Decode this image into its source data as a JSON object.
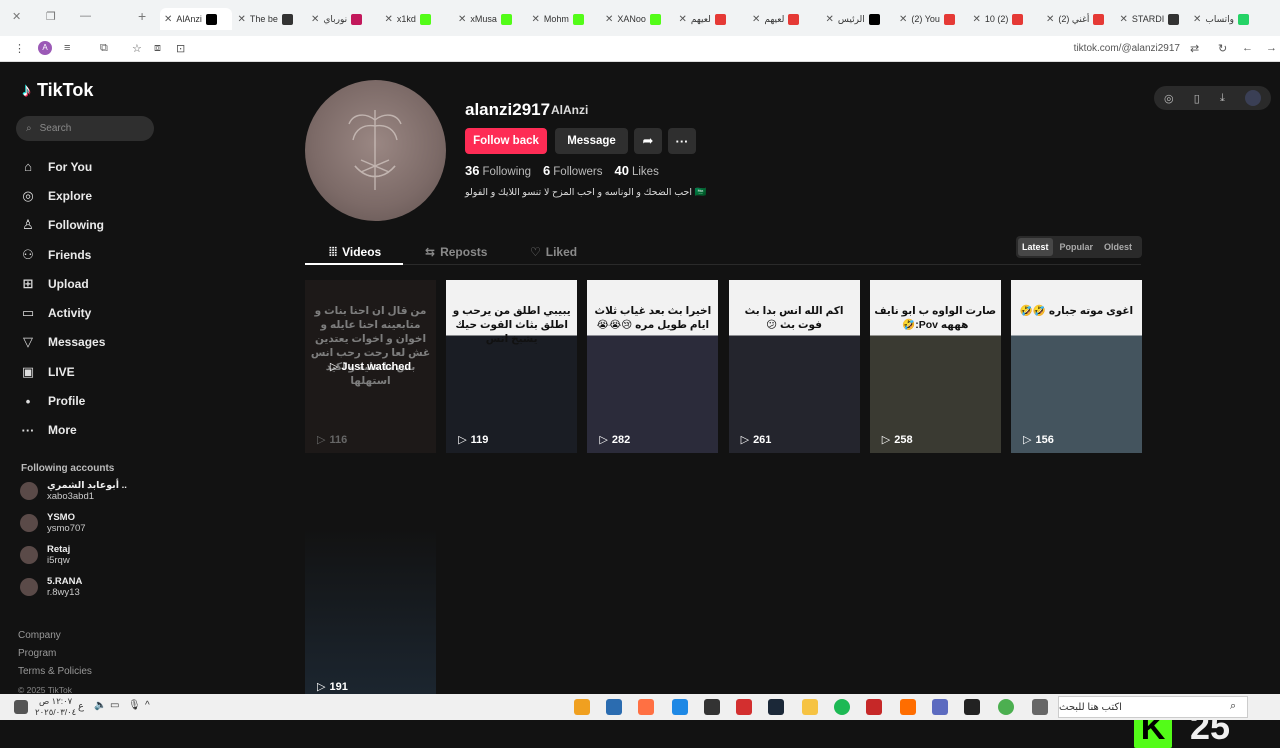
{
  "browser": {
    "tabs": [
      {
        "label": "AlAnzi",
        "color": "#000000",
        "active": true
      },
      {
        "label": "The be",
        "color": "#333333"
      },
      {
        "label": "نورباي",
        "color": "#c2185b"
      },
      {
        "label": "x1kd",
        "color": "#53fc18"
      },
      {
        "label": "xMusa",
        "color": "#53fc18"
      },
      {
        "label": "Mohm",
        "color": "#53fc18"
      },
      {
        "label": "XANoo",
        "color": "#53fc18"
      },
      {
        "label": "لعيهم",
        "color": "#e53935"
      },
      {
        "label": "لعيهم",
        "color": "#e53935"
      },
      {
        "label": "الرئيس",
        "color": "#000000"
      },
      {
        "label": "(2) You",
        "color": "#e53935"
      },
      {
        "label": "10 (2)",
        "color": "#e53935"
      },
      {
        "label": "(2) أغني",
        "color": "#e53935"
      },
      {
        "label": "STARDI",
        "color": "#333333"
      },
      {
        "label": "واتساب",
        "color": "#25d366"
      }
    ],
    "url": "tiktok.com/@alanzi2917",
    "profile_initial": "A"
  },
  "sidebar": {
    "logo": "TikTok",
    "search_placeholder": "Search",
    "nav": [
      {
        "label": "For You",
        "icon": "home-icon",
        "glyph": "⌂"
      },
      {
        "label": "Explore",
        "icon": "compass-icon",
        "glyph": "◎"
      },
      {
        "label": "Following",
        "icon": "user-follow-icon",
        "glyph": "♙"
      },
      {
        "label": "Friends",
        "icon": "friends-icon",
        "glyph": "⚇"
      },
      {
        "label": "Upload",
        "icon": "upload-icon",
        "glyph": "⊞"
      },
      {
        "label": "Activity",
        "icon": "activity-icon",
        "glyph": "▭"
      },
      {
        "label": "Messages",
        "icon": "messages-icon",
        "glyph": "▽"
      },
      {
        "label": "LIVE",
        "icon": "live-icon",
        "glyph": "▣"
      },
      {
        "label": "Profile",
        "icon": "profile-icon",
        "glyph": "•"
      },
      {
        "label": "More",
        "icon": "more-icon",
        "glyph": "···"
      }
    ],
    "following_title": "Following accounts",
    "following": [
      {
        "name": "أبوعابد الشمري ..",
        "handle": "xabo3abd1"
      },
      {
        "name": "YSMO",
        "handle": "ysmo707"
      },
      {
        "name": "Retaj",
        "handle": "i5rqw"
      },
      {
        "name": "5.RANA",
        "handle": "r.8wy13"
      }
    ],
    "footer": [
      "Company",
      "Program",
      "Terms & Policies"
    ],
    "copyright": "© 2025 TikTok"
  },
  "profile": {
    "username": "alanzi2917",
    "display_name": "AlAnzi",
    "follow_label": "Follow back",
    "message_label": "Message",
    "following_count": "36",
    "following_label": "Following",
    "followers_count": "6",
    "followers_label": "Followers",
    "likes_count": "40",
    "likes_label": "Likes",
    "bio": "احب الضحك و الوناسه و احب المزح لا تنسو اللايك و الفولو 🇸🇦"
  },
  "content_tabs": {
    "videos": "Videos",
    "reposts": "Reposts",
    "liked": "Liked",
    "sort": [
      "Latest",
      "Popular",
      "Oldest"
    ]
  },
  "videos": [
    {
      "caption": "من قال ان احنا بنات و متابعينه احنا عايله و اخوان و اخوات يعتدين غش لعا رحت رحب انس بس ما عليه و اكيد استهلها",
      "views": "116",
      "overlay": "Just watched",
      "bg": "#2a2320"
    },
    {
      "caption": "يبيبي اطلق من يرحب و اطلق بثاث القوت حيك يشيخ انس",
      "views": "119",
      "bg": "#1a1d24"
    },
    {
      "caption": "اخيرا بث بعد غياب ثلاث ايام طويل مره 😢😭😭",
      "views": "282",
      "bg": "#2b2b3a"
    },
    {
      "caption": "اكم الله انس بدا بث فوت بث 😕",
      "views": "261",
      "bg": "#24252d"
    },
    {
      "caption": "صارت الواوه ب ابو نايف هههه Pov:🤣",
      "views": "258",
      "bg": "#3a3a32"
    },
    {
      "caption": "اغوى موته جباره 🤣🤣",
      "views": "156",
      "bg": "#44545e"
    },
    {
      "caption": "",
      "views": "191",
      "bg": "#1c2630"
    }
  ],
  "overlay_counter": "25",
  "taskbar": {
    "clock_time": "١٢:٠٧ ص",
    "clock_date": "٢٠٢٥/٠٣/٠٤",
    "search_placeholder": "اكتب هنا للبحث"
  }
}
